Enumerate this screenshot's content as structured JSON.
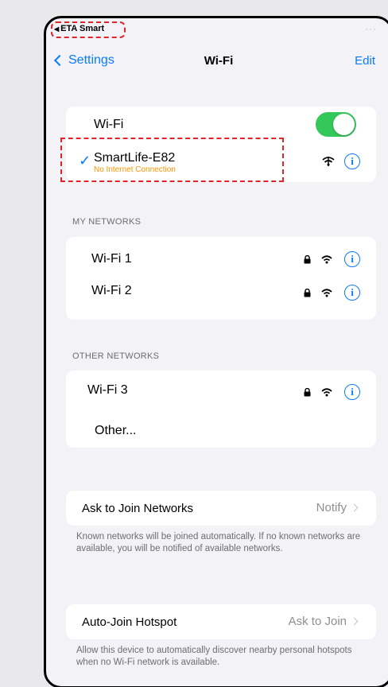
{
  "status_bar": {
    "back_app_label": "ETA Smart",
    "indicator": "···"
  },
  "navbar": {
    "back_label": "Settings",
    "title": "Wi-Fi",
    "edit_label": "Edit"
  },
  "wifi_group": {
    "wifi_label": "Wi-Fi",
    "wifi_enabled": true,
    "connected_network": "SmartLife-E82",
    "connection_status": "No Internet Connection"
  },
  "my_networks": {
    "header": "MY NETWORKS",
    "items": [
      {
        "label": "Wi-Fi 1"
      },
      {
        "label": "Wi-Fi 2"
      }
    ]
  },
  "other_networks": {
    "header": "OTHER NETWORKS",
    "items": [
      {
        "label": "Wi-Fi 3"
      }
    ],
    "other_label": "Other..."
  },
  "ask_to_join": {
    "label": "Ask to Join Networks",
    "value": "Notify",
    "footnote": "Known networks will be joined automatically. If no known networks are available, you will be notified of available networks."
  },
  "auto_join": {
    "label": "Auto-Join Hotspot",
    "value": "Ask to Join",
    "footnote": "Allow this device to automatically discover nearby personal hotspots when no Wi-Fi network is available."
  },
  "colors": {
    "accent": "#0a7aff",
    "toggle_on": "#34c759",
    "warning": "#ff9500",
    "highlight": "#e0242a"
  }
}
